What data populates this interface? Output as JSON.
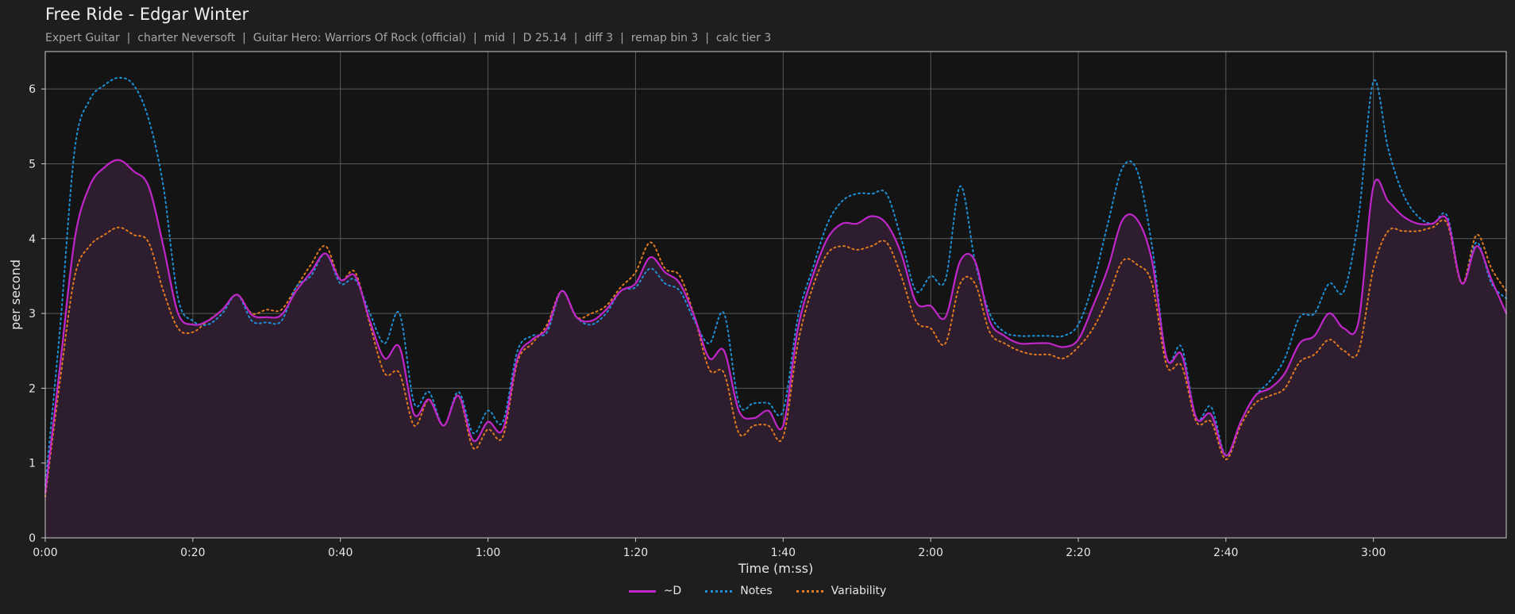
{
  "header": {
    "title": "Free Ride - Edgar Winter",
    "subtitle": "Expert Guitar  |  charter Neversoft  |  Guitar Hero: Warriors Of Rock (official)  |  mid  |  D 25.14  |  diff 3  |  remap bin 3  |  calc tier 3"
  },
  "colors": {
    "background": "#1e1e1e",
    "plot_bg": "#141414",
    "d_line": "#c026c9",
    "d_fill": "#2e1d2e",
    "notes": "#1f8fd6",
    "variability": "#e07a20",
    "grid": "#5a5a5a"
  },
  "chart_data": {
    "type": "line",
    "xlabel": "Time (m:ss)",
    "ylabel": "per second",
    "xlim": [
      0,
      198
    ],
    "ylim": [
      0,
      6.5
    ],
    "x_ticks": [
      0,
      20,
      40,
      60,
      80,
      100,
      120,
      140,
      160,
      180
    ],
    "x_tick_labels": [
      "0:00",
      "0:20",
      "0:40",
      "1:00",
      "1:20",
      "1:40",
      "2:00",
      "2:20",
      "2:40",
      "3:00"
    ],
    "y_ticks": [
      0,
      1,
      2,
      3,
      4,
      5,
      6
    ],
    "y_tick_labels": [
      "0",
      "1",
      "2",
      "3",
      "4",
      "5",
      "6"
    ],
    "grid": true,
    "legend_position": "bottom-center",
    "x": [
      0,
      2,
      4,
      6,
      8,
      10,
      12,
      14,
      16,
      18,
      20,
      22,
      24,
      26,
      28,
      30,
      32,
      34,
      36,
      38,
      40,
      42,
      44,
      46,
      48,
      50,
      52,
      54,
      56,
      58,
      60,
      62,
      64,
      66,
      68,
      70,
      72,
      74,
      76,
      78,
      80,
      82,
      84,
      86,
      88,
      90,
      92,
      94,
      96,
      98,
      100,
      102,
      104,
      106,
      108,
      110,
      112,
      114,
      116,
      118,
      120,
      122,
      124,
      126,
      128,
      130,
      132,
      134,
      136,
      138,
      140,
      142,
      144,
      146,
      148,
      150,
      152,
      154,
      156,
      158,
      160,
      162,
      164,
      166,
      168,
      170,
      172,
      174,
      176,
      178,
      180,
      182,
      184,
      186,
      188,
      190,
      192,
      194,
      196,
      198
    ],
    "series": [
      {
        "name": "~D",
        "style": "solid",
        "values": [
          0.6,
          2.3,
          4.0,
          4.7,
          4.95,
          5.05,
          4.9,
          4.7,
          3.9,
          3.0,
          2.85,
          2.9,
          3.05,
          3.25,
          2.98,
          2.95,
          2.98,
          3.3,
          3.55,
          3.8,
          3.45,
          3.5,
          2.9,
          2.4,
          2.55,
          1.65,
          1.85,
          1.5,
          1.9,
          1.3,
          1.55,
          1.45,
          2.4,
          2.65,
          2.8,
          3.3,
          2.95,
          2.9,
          3.05,
          3.3,
          3.4,
          3.75,
          3.55,
          3.4,
          2.95,
          2.4,
          2.5,
          1.7,
          1.6,
          1.7,
          1.5,
          2.8,
          3.5,
          4.0,
          4.2,
          4.2,
          4.3,
          4.2,
          3.8,
          3.15,
          3.1,
          2.95,
          3.7,
          3.7,
          2.9,
          2.7,
          2.6,
          2.6,
          2.6,
          2.55,
          2.65,
          3.1,
          3.6,
          4.25,
          4.25,
          3.7,
          2.4,
          2.45,
          1.6,
          1.65,
          1.1,
          1.55,
          1.9,
          2.0,
          2.2,
          2.6,
          2.7,
          3.0,
          2.8,
          2.9,
          4.7,
          4.5,
          4.3,
          4.2,
          4.2,
          4.25,
          3.4,
          3.9,
          3.45,
          3.0
        ]
      },
      {
        "name": "Notes",
        "style": "dotted",
        "values": [
          0.7,
          2.8,
          5.2,
          5.85,
          6.05,
          6.15,
          6.05,
          5.6,
          4.7,
          3.2,
          2.9,
          2.85,
          3.0,
          3.25,
          2.9,
          2.88,
          2.9,
          3.35,
          3.5,
          3.8,
          3.4,
          3.45,
          3.0,
          2.6,
          3.0,
          1.8,
          1.95,
          1.5,
          1.95,
          1.4,
          1.7,
          1.55,
          2.5,
          2.7,
          2.75,
          3.3,
          2.95,
          2.85,
          3.0,
          3.3,
          3.35,
          3.6,
          3.4,
          3.3,
          2.9,
          2.6,
          3.0,
          1.8,
          1.8,
          1.8,
          1.7,
          2.95,
          3.6,
          4.2,
          4.5,
          4.6,
          4.6,
          4.6,
          4.0,
          3.3,
          3.5,
          3.45,
          4.7,
          3.7,
          3.0,
          2.75,
          2.7,
          2.7,
          2.7,
          2.7,
          2.85,
          3.4,
          4.2,
          4.95,
          4.9,
          3.9,
          2.4,
          2.55,
          1.6,
          1.75,
          1.1,
          1.55,
          1.9,
          2.1,
          2.4,
          2.95,
          3.0,
          3.4,
          3.3,
          4.3,
          6.1,
          5.2,
          4.6,
          4.3,
          4.2,
          4.3,
          3.4,
          3.95,
          3.4,
          3.2
        ]
      },
      {
        "name": "Variability",
        "style": "dotted",
        "values": [
          0.55,
          2.1,
          3.5,
          3.9,
          4.05,
          4.15,
          4.05,
          3.95,
          3.3,
          2.8,
          2.75,
          2.9,
          3.05,
          3.25,
          3.0,
          3.05,
          3.05,
          3.35,
          3.65,
          3.9,
          3.45,
          3.55,
          2.85,
          2.2,
          2.2,
          1.5,
          1.85,
          1.5,
          1.9,
          1.2,
          1.45,
          1.35,
          2.35,
          2.6,
          2.85,
          3.3,
          2.95,
          3.0,
          3.1,
          3.35,
          3.55,
          3.95,
          3.6,
          3.5,
          2.95,
          2.25,
          2.2,
          1.4,
          1.5,
          1.5,
          1.35,
          2.6,
          3.35,
          3.8,
          3.9,
          3.85,
          3.9,
          3.95,
          3.5,
          2.9,
          2.8,
          2.6,
          3.4,
          3.4,
          2.75,
          2.6,
          2.5,
          2.45,
          2.45,
          2.4,
          2.55,
          2.8,
          3.2,
          3.7,
          3.65,
          3.4,
          2.3,
          2.3,
          1.55,
          1.55,
          1.05,
          1.5,
          1.8,
          1.9,
          2.0,
          2.35,
          2.45,
          2.65,
          2.5,
          2.5,
          3.6,
          4.1,
          4.1,
          4.1,
          4.15,
          4.2,
          3.4,
          4.05,
          3.6,
          3.3
        ]
      }
    ]
  }
}
